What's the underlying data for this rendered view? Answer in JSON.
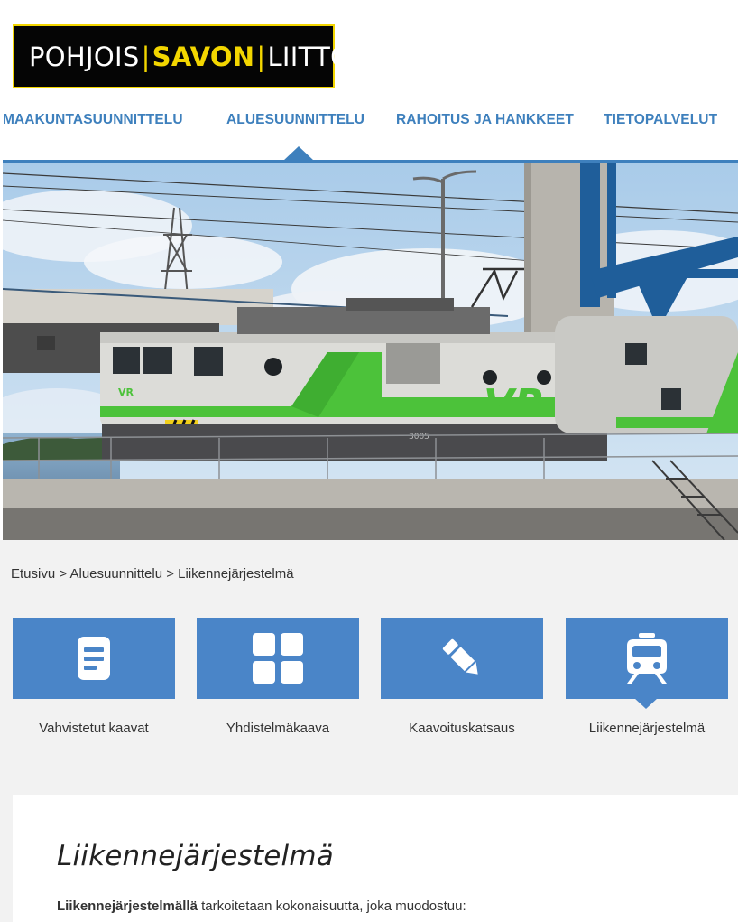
{
  "logo": {
    "part1": "POHJOIS",
    "part2": "SAVON",
    "part3": "LIITTO",
    "separator": "|"
  },
  "nav": {
    "items": [
      {
        "label": "MAAKUNTASUUNNITTELU",
        "active": false
      },
      {
        "label": "ALUESUUNNITTELU",
        "active": true
      },
      {
        "label": "RAHOITUS JA HANKKEET",
        "active": false
      },
      {
        "label": "TIETOPALVELUT",
        "active": false
      }
    ]
  },
  "breadcrumb": {
    "items": [
      "Etusivu",
      "Aluesuunnittelu",
      "Liikennejärjestelmä"
    ],
    "separator": " > "
  },
  "tiles": [
    {
      "label": "Vahvistetut kaavat",
      "icon": "document-icon"
    },
    {
      "label": "Yhdistelmäkaava",
      "icon": "grid-icon"
    },
    {
      "label": "Kaavoituskatsaus",
      "icon": "pencil-icon"
    },
    {
      "label": "Liikennejärjestelmä",
      "icon": "train-icon",
      "active": true
    }
  ],
  "article": {
    "title": "Liikennejärjestelmä",
    "intro_bold": "Liikennejärjestelmällä",
    "intro_rest": " tarkoitetaan kokonaisuutta, joka muodostuu:"
  },
  "hero": {
    "locomotive_mark": "VR",
    "locomotive_number": "3005"
  },
  "colors": {
    "accent": "#3e80bd",
    "tile": "#4a85c8",
    "logo_yellow": "#f3d600",
    "vr_green": "#4cc23a"
  }
}
